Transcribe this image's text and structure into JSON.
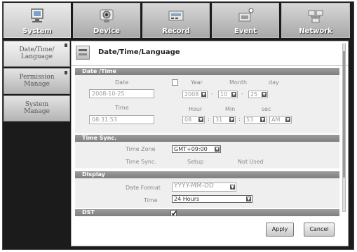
{
  "tabs": [
    {
      "label": "System",
      "icon": "monitor-icon"
    },
    {
      "label": "Device",
      "icon": "camera-icon"
    },
    {
      "label": "Record",
      "icon": "recorder-icon"
    },
    {
      "label": "Event",
      "icon": "alarm-icon"
    },
    {
      "label": "Network",
      "icon": "network-icon"
    }
  ],
  "sidebar": {
    "items": [
      {
        "line1": "Date/Time/",
        "line2": "Language"
      },
      {
        "line1": "Permission",
        "line2": "Manage"
      },
      {
        "line1": "System",
        "line2": "Manage"
      }
    ]
  },
  "panel": {
    "title": "Date/Time/Language"
  },
  "datetime": {
    "header": "Date /Time",
    "date_label": "Date",
    "date_value": "2008-10-25",
    "time_label": "Time",
    "time_value": "08:31:53",
    "year_label": "Year",
    "month_label": "Month",
    "day_label": "day",
    "year_value": "2008",
    "month_value": "10",
    "day_value": "25",
    "hour_label": "Hour",
    "min_label": "Min",
    "sec_label": "sec",
    "hour_value": "08",
    "min_value": "31",
    "sec_value": "53",
    "ampm_value": "AM"
  },
  "timesync": {
    "header": "Time Sync.",
    "timezone_label": "Time Zone",
    "timezone_value": "GMT+09:00",
    "sync_label": "Time Sync.",
    "setup_label": "Setup",
    "status_value": "Not Used"
  },
  "display": {
    "header": "Display",
    "date_format_label": "Date Format",
    "date_format_value": "YYYY-MM-DD",
    "time_label": "Time",
    "time_value": "24 Hours"
  },
  "dst": {
    "header": "DST"
  },
  "buttons": {
    "apply": "Apply",
    "cancel": "Cancel"
  }
}
